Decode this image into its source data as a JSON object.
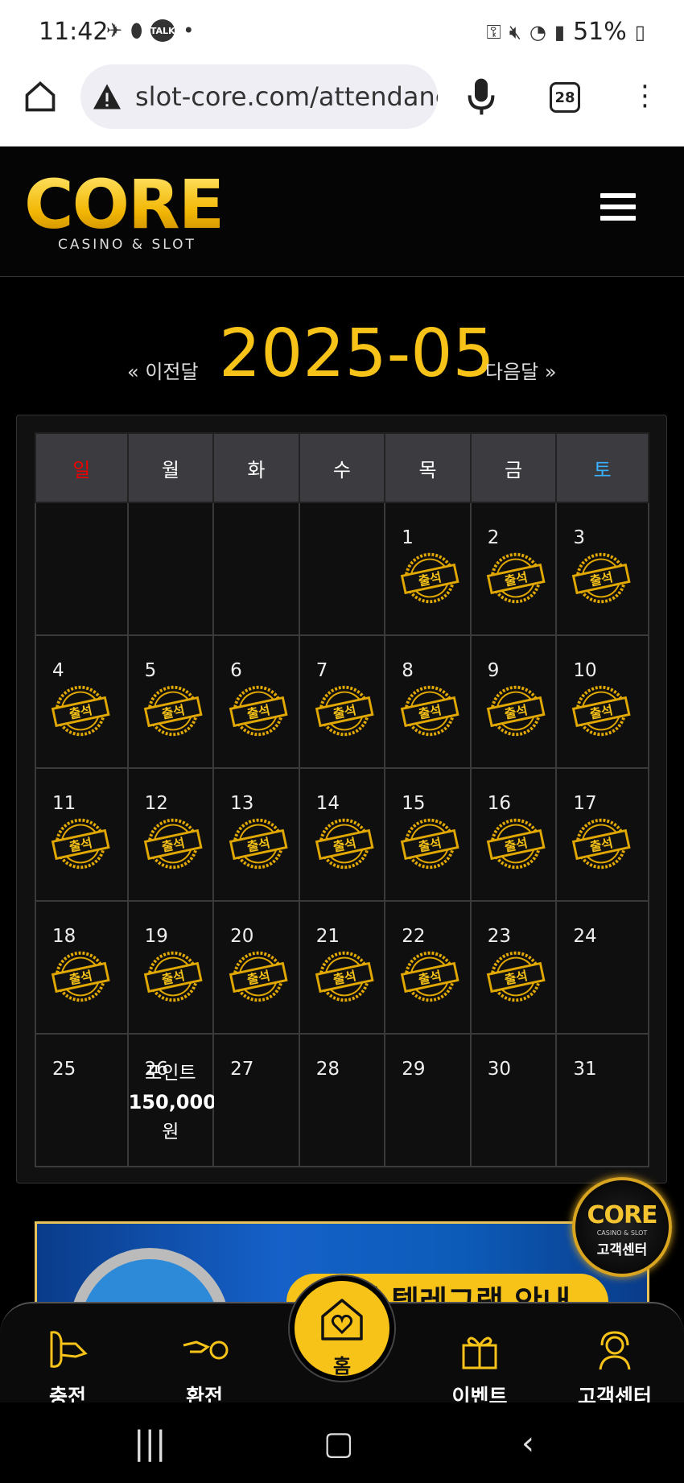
{
  "statusbar": {
    "time": "11:42",
    "talk": "TALK",
    "battery": "51%"
  },
  "browser": {
    "url": "slot-core.com/attendanc",
    "tab_count": "28"
  },
  "site": {
    "logo_word": "CORE",
    "logo_tag": "CASINO & SLOT"
  },
  "month_nav": {
    "prev": "« 이전달",
    "title": "2025-05",
    "next": "다음달 »"
  },
  "calendar": {
    "weekdays": [
      "일",
      "월",
      "화",
      "수",
      "목",
      "금",
      "토"
    ],
    "stamp_text": "출석",
    "point_label": "포인트",
    "point_amount": "150,000",
    "point_unit": "원"
  },
  "banner": {
    "text": "공식 텔레그램 안내"
  },
  "float_badge": {
    "word": "CORE",
    "tag": "CASINO & SLOT",
    "label": "고객센터"
  },
  "bottom_nav": {
    "charge": "충전",
    "exchange": "환전",
    "home": "홈",
    "event": "이벤트",
    "support": "고객센터"
  },
  "colors": {
    "accent": "#f7c318",
    "sunday": "#e00000",
    "saturday": "#3ab0ff"
  }
}
